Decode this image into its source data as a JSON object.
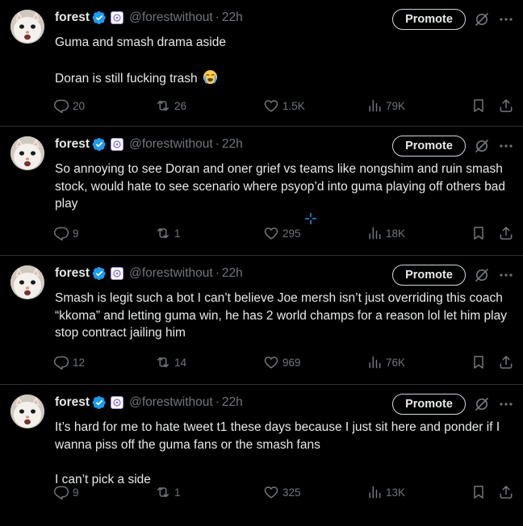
{
  "colors": {
    "background": "#000000",
    "text": "#e7e9ea",
    "muted": "#71767b",
    "verified": "#1d9bf0",
    "divider": "#2f3336"
  },
  "tweets": [
    {
      "name": "forest",
      "handle": "@forestwithout",
      "sep": "·",
      "time": "22h",
      "promote": "Promote",
      "lines": [
        "Guma and smash drama aside",
        "Doran is still fucking trash"
      ],
      "emoji": "loudly-crying-face",
      "replies": "20",
      "retweets": "26",
      "likes": "1.5K",
      "views": "79K"
    },
    {
      "name": "forest",
      "handle": "@forestwithout",
      "sep": "·",
      "time": "22h",
      "promote": "Promote",
      "lines": [
        "So annoying to see Doran and oner grief vs teams like nongshim and ruin smash stock, would hate to see scenario where psyop’d into guma playing off others bad play"
      ],
      "replies": "9",
      "retweets": "1",
      "likes": "295",
      "views": "18K"
    },
    {
      "name": "forest",
      "handle": "@forestwithout",
      "sep": "·",
      "time": "22h",
      "promote": "Promote",
      "lines": [
        "Smash is legit such a bot I can’t believe Joe mersh isn’t just overriding this coach “kkoma” and letting guma win, he has 2 world champs for a reason lol let him play stop contract jailing him"
      ],
      "replies": "12",
      "retweets": "14",
      "likes": "969",
      "views": "76K"
    },
    {
      "name": "forest",
      "handle": "@forestwithout",
      "sep": "·",
      "time": "22h",
      "promote": "Promote",
      "lines": [
        "It’s hard for me to hate tweet t1 these days because I just sit here and ponder if I wanna piss off the guma fans or the smash fans",
        "I can’t pick a side"
      ],
      "replies": "9",
      "retweets": "1",
      "likes": "325",
      "views": "13K"
    }
  ]
}
